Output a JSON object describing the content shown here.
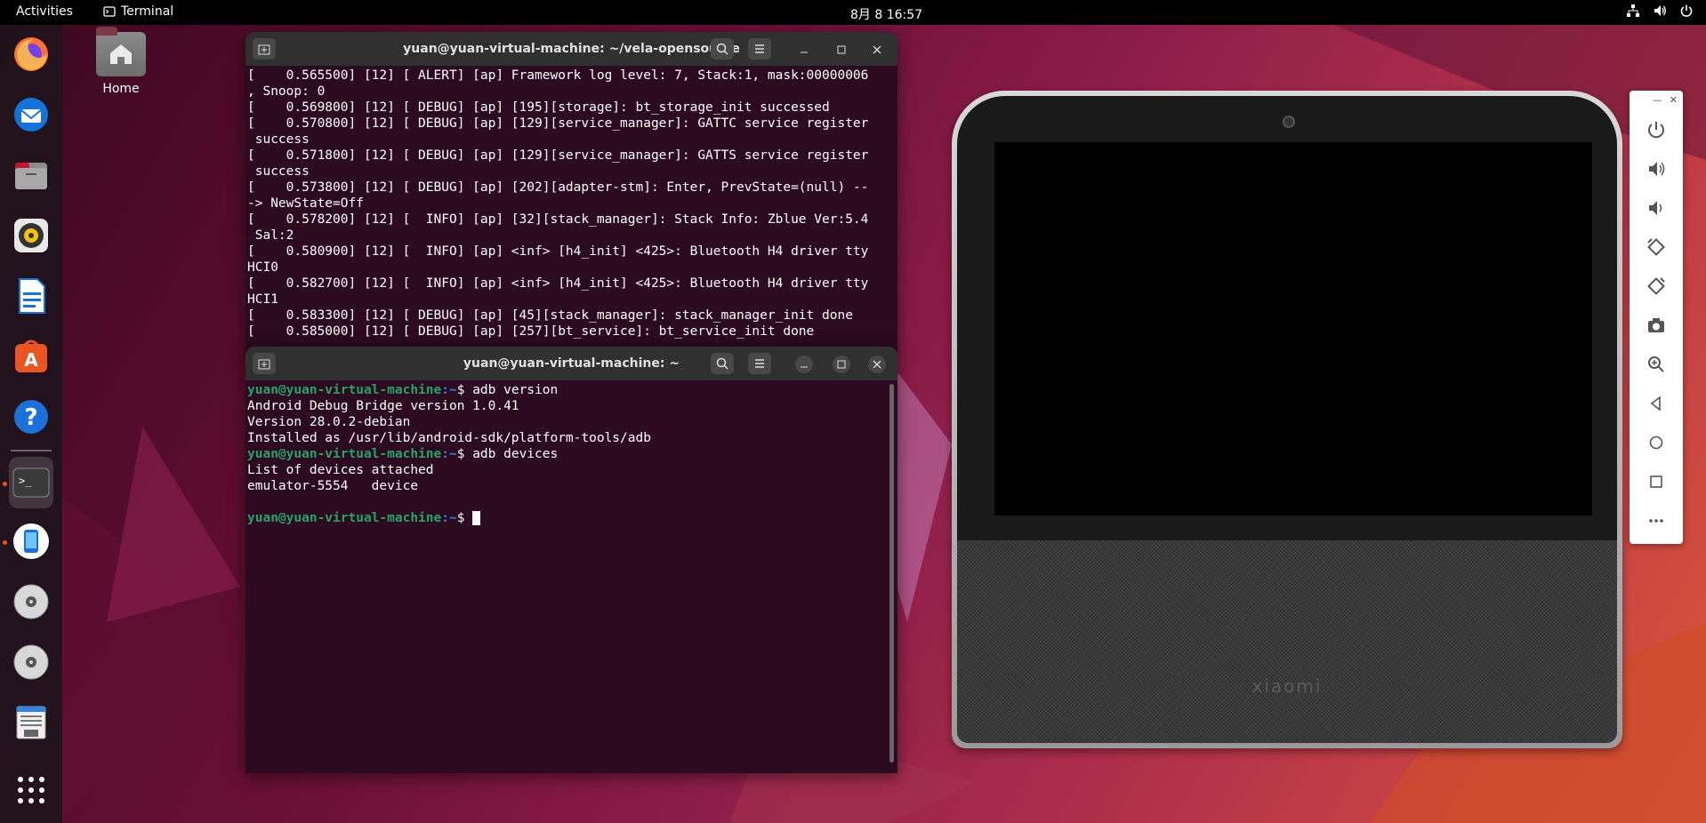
{
  "topbar": {
    "activities": "Activities",
    "app_name": "Terminal",
    "clock": "8月 8  16:57"
  },
  "desktop": {
    "home_label": "Home"
  },
  "dock": {
    "items": [
      "firefox-icon",
      "thunderbird-icon",
      "files-icon",
      "rhythmbox-icon",
      "libreoffice-writer-icon",
      "app-center-icon",
      "help-icon",
      "terminal-icon",
      "emulator-icon",
      "disc-icon",
      "disc-icon",
      "text-editor-icon",
      "show-apps-icon"
    ]
  },
  "term_top": {
    "title": "yuan@yuan-virtual-machine: ~/vela-opensource",
    "lines": [
      "[    0.565500] [12] [ ALERT] [ap] Framework log level: 7, Stack:1, mask:00000006",
      ", Snoop: 0",
      "[    0.569800] [12] [ DEBUG] [ap] [195][storage]: bt_storage_init successed",
      "[    0.570800] [12] [ DEBUG] [ap] [129][service_manager]: GATTC service register",
      " success",
      "[    0.571800] [12] [ DEBUG] [ap] [129][service_manager]: GATTS service register",
      " success",
      "[    0.573800] [12] [ DEBUG] [ap] [202][adapter-stm]: Enter, PrevState=(null) --",
      "-> NewState=Off",
      "[    0.578200] [12] [  INFO] [ap] [32][stack_manager]: Stack Info: Zblue Ver:5.4",
      " Sal:2",
      "[    0.580900] [12] [  INFO] [ap] <inf> [h4_init] <425>: Bluetooth H4 driver tty",
      "HCI0",
      "[    0.582700] [12] [  INFO] [ap] <inf> [h4_init] <425>: Bluetooth H4 driver tty",
      "HCI1",
      "[    0.583300] [12] [ DEBUG] [ap] [45][stack_manager]: stack_manager_init done",
      "[    0.585000] [12] [ DEBUG] [ap] [257][bt_service]: bt_service_init done"
    ]
  },
  "term_bottom": {
    "title": "yuan@yuan-virtual-machine: ~",
    "prompt_user": "yuan@yuan-virtual-machine",
    "prompt_path": ":~",
    "prompt_dollar": "$ ",
    "cmd1": "adb version",
    "out1": "Android Debug Bridge version 1.0.41",
    "out2": "Version 28.0.2-debian",
    "out3": "Installed as /usr/lib/android-sdk/platform-tools/adb",
    "cmd2": "adb devices",
    "out4": "List of devices attached",
    "out5": "emulator-5554   device"
  },
  "device": {
    "brand": "xiaomi"
  },
  "controls": {
    "items": [
      "power-icon",
      "volume-up-icon",
      "volume-down-icon",
      "rotate-left-icon",
      "rotate-right-icon",
      "screenshot-icon",
      "zoom-icon",
      "back-icon",
      "home-icon",
      "overview-icon",
      "more-icon"
    ]
  }
}
